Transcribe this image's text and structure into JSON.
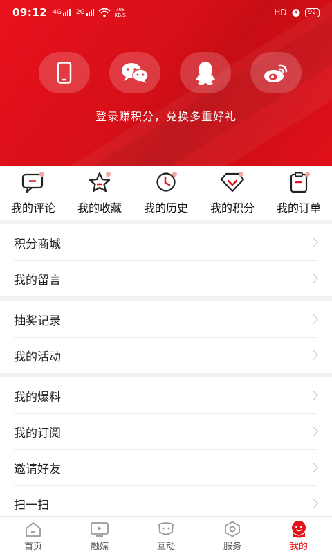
{
  "status": {
    "time": "09:12",
    "net1": "4G",
    "net2": "2G",
    "speed_value": "708",
    "speed_unit": "KB/S",
    "hd": "HD",
    "battery": "92"
  },
  "colors": {
    "brand": "#e3121b",
    "header_bg": "#d60f18"
  },
  "social": [
    {
      "name": "phone-login-icon"
    },
    {
      "name": "wechat-icon"
    },
    {
      "name": "qq-icon"
    },
    {
      "name": "weibo-icon"
    }
  ],
  "login_tip": "登录赚积分，兑换多重好礼",
  "quick": [
    {
      "icon": "comment-icon",
      "label": "我的评论"
    },
    {
      "icon": "star-icon",
      "label": "我的收藏"
    },
    {
      "icon": "clock-icon",
      "label": "我的历史"
    },
    {
      "icon": "diamond-icon",
      "label": "我的积分"
    },
    {
      "icon": "clipboard-icon",
      "label": "我的订单"
    }
  ],
  "groups": [
    [
      "积分商城",
      "我的留言"
    ],
    [
      "抽奖记录",
      "我的活动"
    ],
    [
      "我的爆料",
      "我的订阅",
      "邀请好友",
      "扫一扫"
    ]
  ],
  "nav": [
    {
      "icon": "home-icon",
      "label": "首页"
    },
    {
      "icon": "tv-icon",
      "label": "融媒"
    },
    {
      "icon": "interact-icon",
      "label": "互动"
    },
    {
      "icon": "service-icon",
      "label": "服务"
    },
    {
      "icon": "mine-icon",
      "label": "我的"
    }
  ]
}
